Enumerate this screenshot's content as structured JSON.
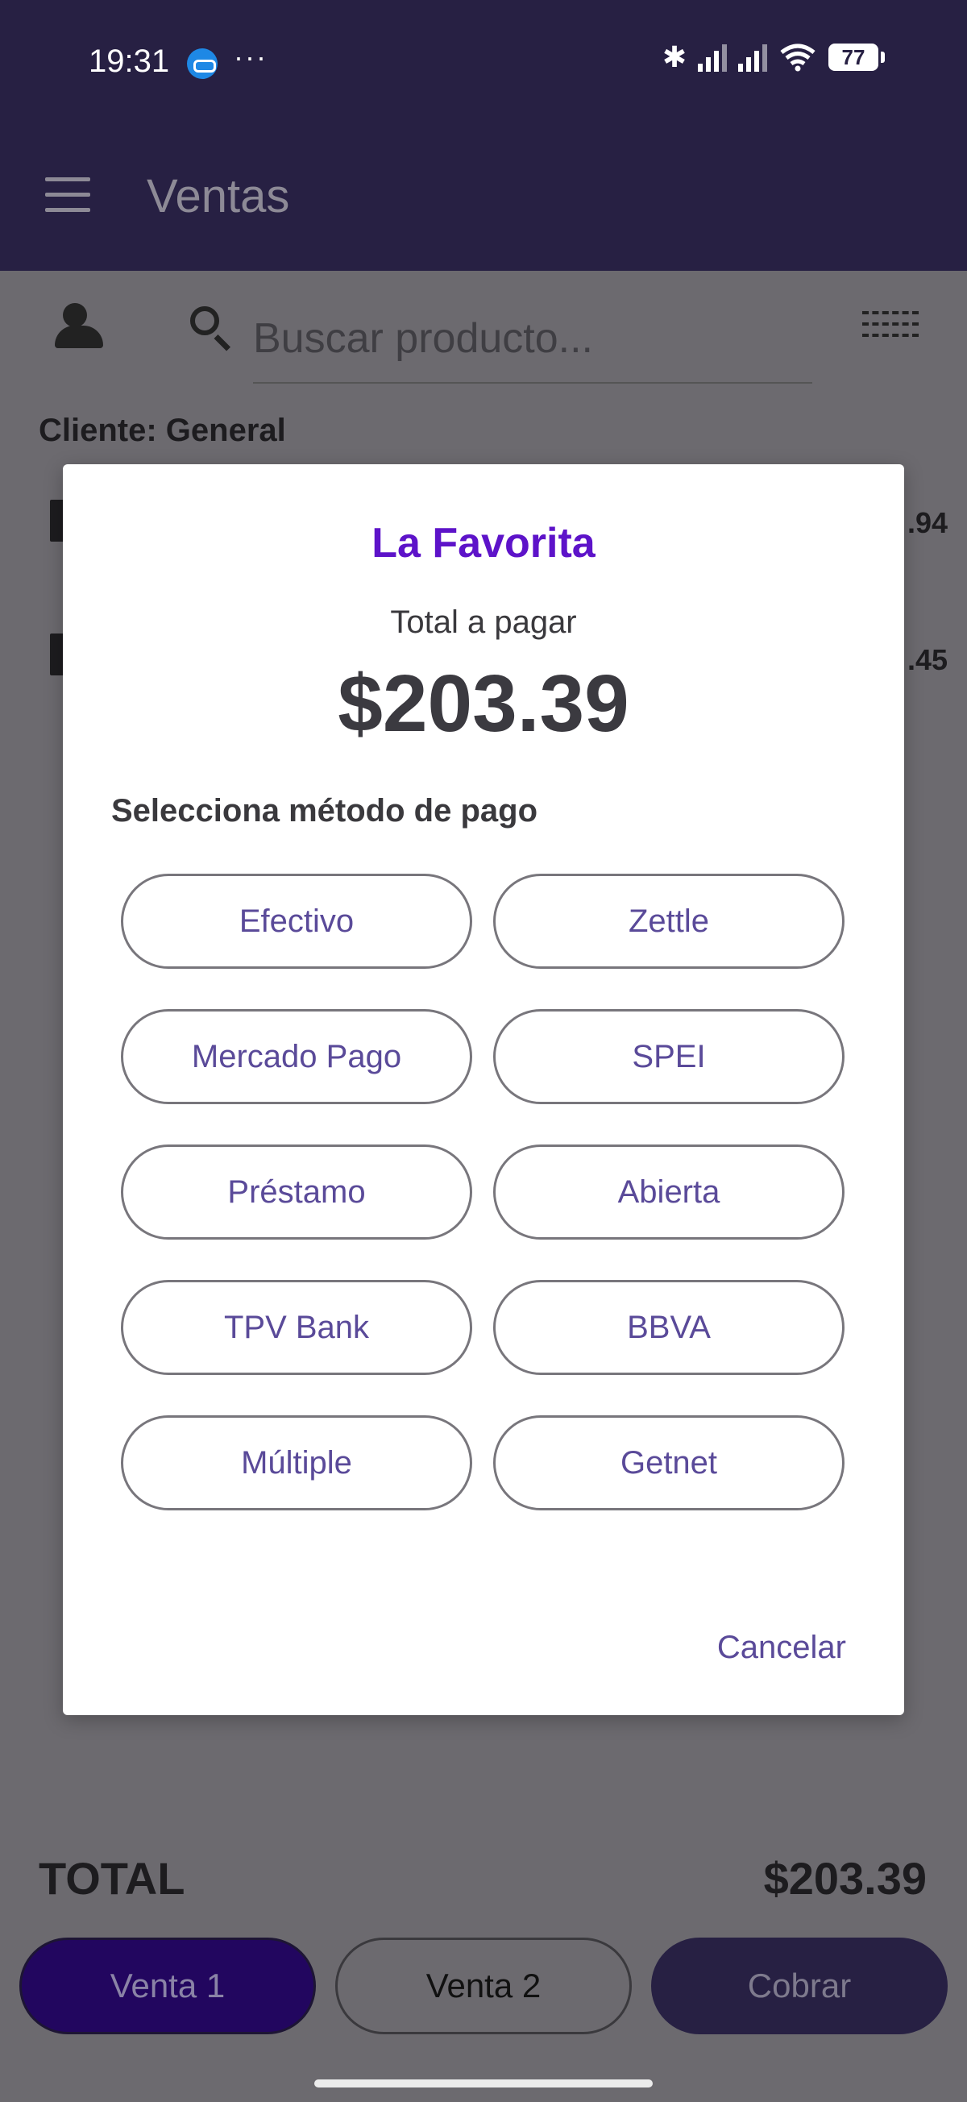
{
  "status_bar": {
    "time": "19:31",
    "more": "···",
    "bluetooth": "✱",
    "battery": "77"
  },
  "app_bar": {
    "title": "Ventas"
  },
  "search": {
    "placeholder": "Buscar producto..."
  },
  "client": {
    "label": "Cliente: General"
  },
  "cart_rows": [
    {
      "price_partial": ".94"
    },
    {
      "price_partial": ".45"
    }
  ],
  "totals": {
    "label": "TOTAL",
    "value": "$203.39"
  },
  "bottom_buttons": {
    "venta1": "Venta 1",
    "venta2": "Venta 2",
    "cobrar": "Cobrar"
  },
  "dialog": {
    "store_name": "La Favorita",
    "total_label": "Total a pagar",
    "amount": "$203.39",
    "method_label": "Selecciona método de pago",
    "methods": [
      "Efectivo",
      "Zettle",
      "Mercado Pago",
      "SPEI",
      "Préstamo",
      "Abierta",
      "TPV Bank",
      "BBVA",
      "Múltiple",
      "Getnet"
    ],
    "cancel_label": "Cancelar"
  },
  "colors": {
    "accent": "#5d13c9",
    "button_text": "#5a4a99",
    "app_bar": "#272043",
    "scrim": "#6c6a6f"
  }
}
